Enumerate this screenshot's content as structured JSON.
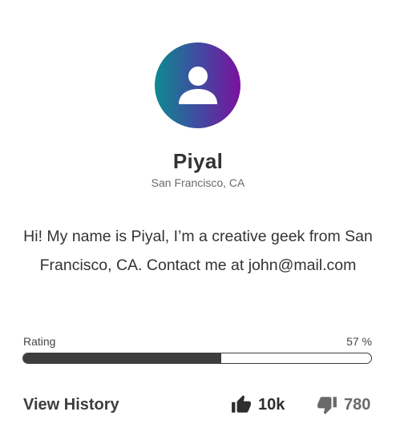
{
  "profile": {
    "name": "Piyal",
    "location": "San Francisco, CA",
    "bio": "Hi! My name is Piyal, I’m a creative geek from San Francisco, CA. Contact me at john@mail.com",
    "avatar_icon": "user-icon"
  },
  "rating": {
    "label": "Rating",
    "value_text": "57 %",
    "percent": 57
  },
  "footer": {
    "history_label": "View History",
    "likes": {
      "icon": "thumbs-up-icon",
      "count": "10k"
    },
    "dislikes": {
      "icon": "thumbs-down-icon",
      "count": "780"
    }
  },
  "colors": {
    "avatar_gradient": [
      "#0f8a8f",
      "#3a52a0",
      "#7a119e"
    ],
    "text_dark": "#333333",
    "bar": "#3d3d3d"
  }
}
